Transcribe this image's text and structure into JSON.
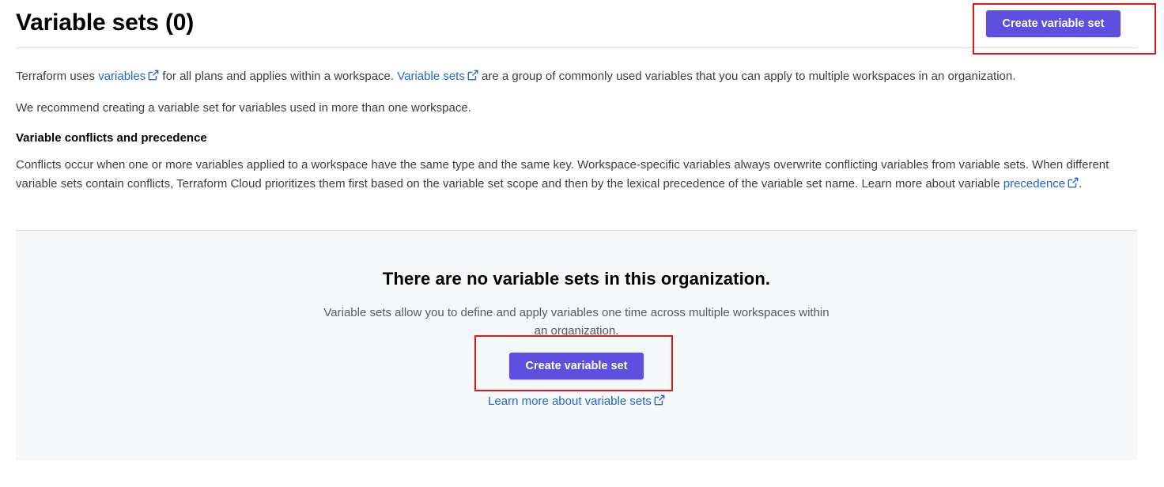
{
  "header": {
    "title": "Variable sets (0)",
    "create_button_label": "Create variable set"
  },
  "intro": {
    "p1_part1": "Terraform uses ",
    "p1_link1": "variables",
    "p1_part2": " for all plans and applies within a workspace. ",
    "p1_link2": "Variable sets",
    "p1_part3": " are a group of commonly used variables that you can apply to multiple workspaces in an organization.",
    "p2": "We recommend creating a variable set for variables used in more than one workspace.",
    "conflicts_heading": "Variable conflicts and precedence",
    "p3_text": "Conflicts occur when one or more variables applied to a workspace have the same type and the same key. Workspace-specific variables always overwrite conflicting variables from variable sets. When different variable sets contain conflicts, Terraform Cloud prioritizes them first based on the variable set scope and then by the lexical precedence of the variable set name. Learn more about variable ",
    "p3_link": "precedence",
    "p3_end": "."
  },
  "empty_state": {
    "title": "There are no variable sets in this organization.",
    "description": "Variable sets allow you to define and apply variables one time across multiple workspaces within an organization.",
    "create_button_label": "Create variable set",
    "learn_more_link": "Learn more about variable sets"
  },
  "colors": {
    "primary_button": "#5d4fe0",
    "link": "#2264d6",
    "highlight_box": "#e4161c",
    "empty_panel_bg": "#f6f7f8"
  },
  "icons": {
    "external_link": "external-link-icon"
  }
}
